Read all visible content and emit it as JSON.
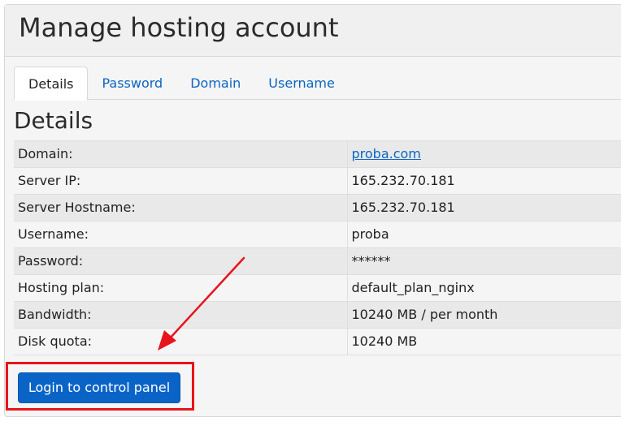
{
  "page": {
    "title": "Manage hosting account"
  },
  "tabs": [
    {
      "label": "Details",
      "active": true
    },
    {
      "label": "Password",
      "active": false
    },
    {
      "label": "Domain",
      "active": false
    },
    {
      "label": "Username",
      "active": false
    }
  ],
  "section": {
    "title": "Details"
  },
  "details": [
    {
      "key": "Domain:",
      "value": "proba.com",
      "is_link": true
    },
    {
      "key": "Server IP:",
      "value": "165.232.70.181"
    },
    {
      "key": "Server Hostname:",
      "value": "165.232.70.181"
    },
    {
      "key": "Username:",
      "value": "proba"
    },
    {
      "key": "Password:",
      "value": "******"
    },
    {
      "key": "Hosting plan:",
      "value": "default_plan_nginx"
    },
    {
      "key": "Bandwidth:",
      "value": "10240 MB / per month"
    },
    {
      "key": "Disk quota:",
      "value": "10240 MB"
    }
  ],
  "actions": {
    "login_label": "Login to control panel"
  },
  "annotation": {
    "color": "#e8141b"
  },
  "colors": {
    "link": "#0b66c2",
    "button": "#0a64c8"
  }
}
